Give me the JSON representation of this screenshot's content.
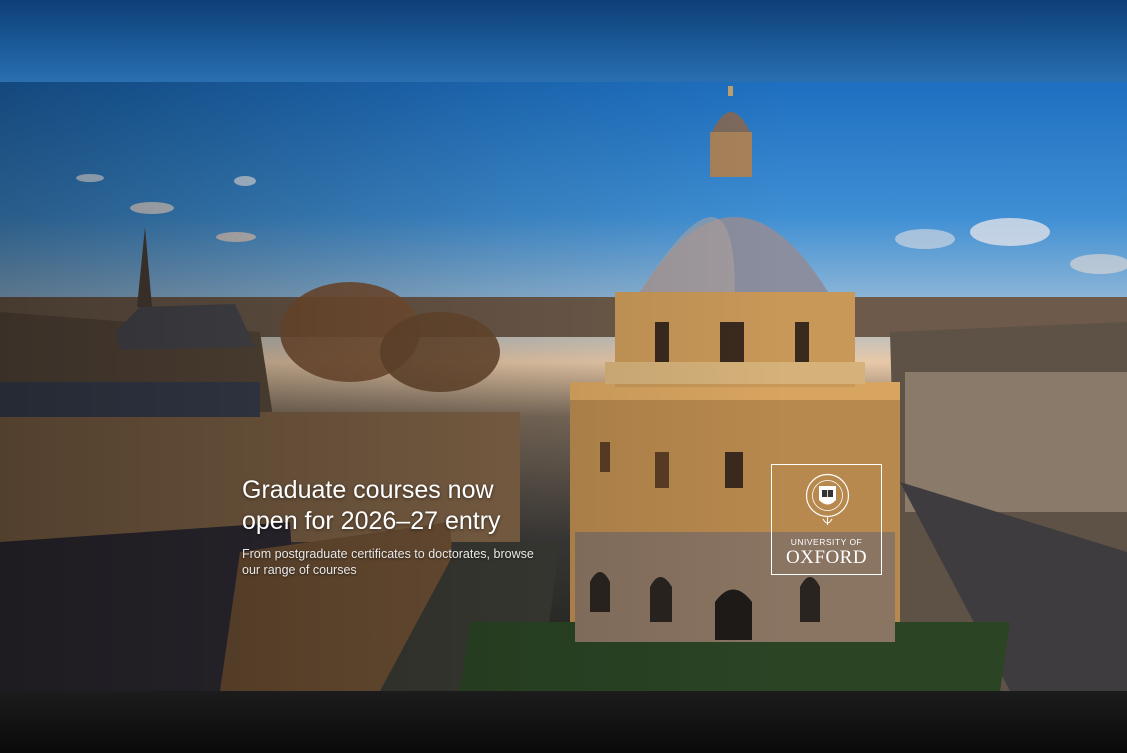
{
  "hero": {
    "headline_line1": "Graduate courses now",
    "headline_line2": "open for 2026–27 entry",
    "subtext": "From postgraduate certificates to doctorates, browse our range of courses",
    "image_description_icon": "radcliffe-camera-photo"
  },
  "logo": {
    "small_text": "UNIVERSITY OF",
    "large_text": "OXFORD"
  },
  "colors": {
    "sky_top": "#1e6fc0",
    "topbar": "#0f3f77",
    "footer": "#0b0b0b",
    "text": "#ffffff"
  }
}
